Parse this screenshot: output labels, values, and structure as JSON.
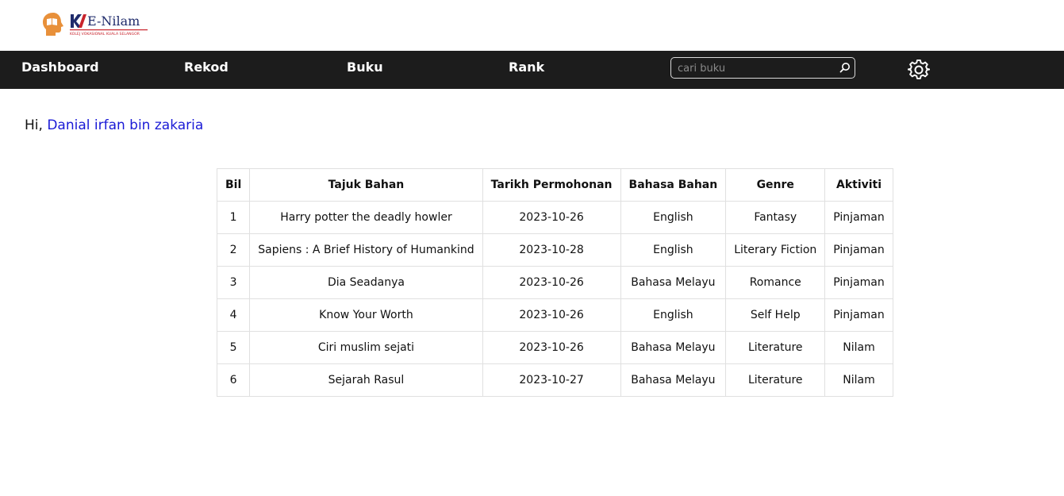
{
  "brand": {
    "name": "E-Nilam",
    "subtitle": "KOLEJ VOKASIONAL KUALA SELANGOR",
    "logo_mark": "KV"
  },
  "nav": {
    "items": [
      {
        "label": "Dashboard"
      },
      {
        "label": "Rekod"
      },
      {
        "label": "Buku"
      },
      {
        "label": "Rank"
      }
    ]
  },
  "search": {
    "placeholder": "cari buku",
    "value": ""
  },
  "icons": {
    "search": "search-icon",
    "settings": "gear-icon"
  },
  "greeting": {
    "prefix": "Hi, ",
    "user": "Danial irfan bin zakaria"
  },
  "table": {
    "headers": [
      "Bil",
      "Tajuk Bahan",
      "Tarikh Permohonan",
      "Bahasa Bahan",
      "Genre",
      "Aktiviti"
    ],
    "rows": [
      [
        "1",
        "Harry potter the deadly howler",
        "2023-10-26",
        "English",
        "Fantasy",
        "Pinjaman"
      ],
      [
        "2",
        "Sapiens : A Brief History of Humankind",
        "2023-10-28",
        "English",
        "Literary Fiction",
        "Pinjaman"
      ],
      [
        "3",
        "Dia Seadanya",
        "2023-10-26",
        "Bahasa Melayu",
        "Romance",
        "Pinjaman"
      ],
      [
        "4",
        "Know Your Worth",
        "2023-10-26",
        "English",
        "Self Help",
        "Pinjaman"
      ],
      [
        "5",
        "Ciri muslim sejati",
        "2023-10-26",
        "Bahasa Melayu",
        "Literature",
        "Nilam"
      ],
      [
        "6",
        "Sejarah Rasul",
        "2023-10-27",
        "Bahasa Melayu",
        "Literature",
        "Nilam"
      ]
    ]
  },
  "colors": {
    "navbar_bg": "#1c1c1c",
    "nav_text": "#ffffff",
    "username": "#1a1ad6",
    "logo_orange": "#e8903a",
    "logo_red": "#c8232c",
    "logo_navy": "#1f2b6b"
  }
}
